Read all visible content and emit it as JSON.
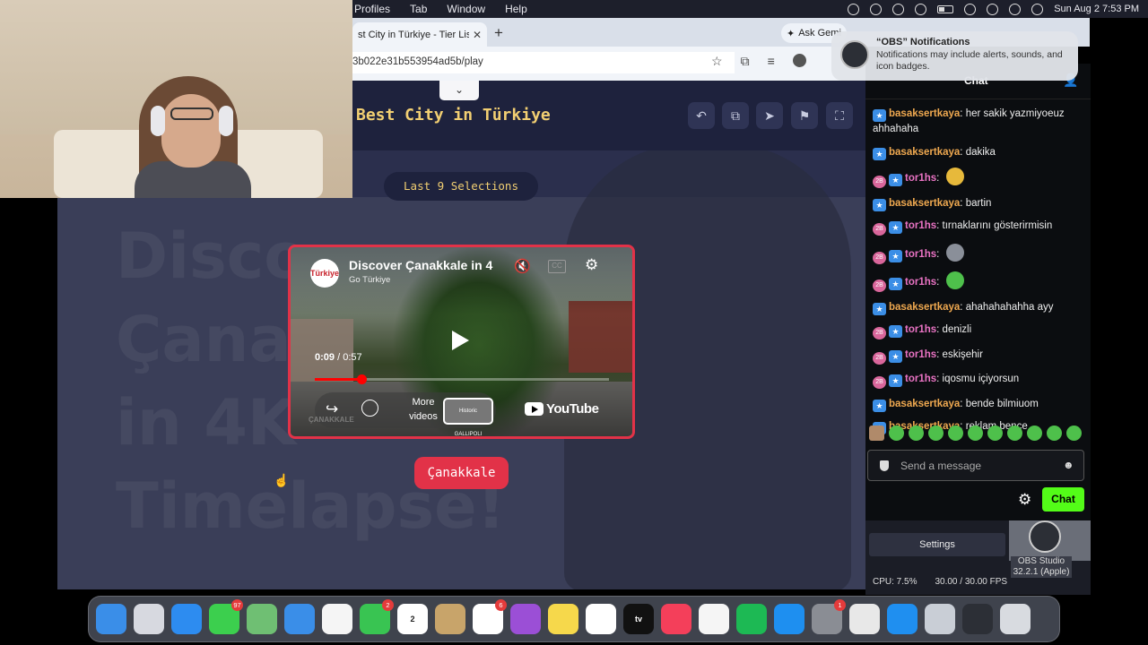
{
  "menubar": {
    "items": [
      "Profiles",
      "Tab",
      "Window",
      "Help"
    ],
    "clock": "Sun Aug 2  7:53 PM"
  },
  "browser": {
    "tab_title": "st City in Türkiye - Tier List",
    "ask_gemini": "Ask Gemi",
    "url": "3b022e31b553954ad5b/play",
    "popout_url": "kick.com/popout/dilaramirar/chat"
  },
  "game": {
    "title": "Best City in Türkiye",
    "last_selections": "Last 9 Selections",
    "city_button": "Çanakkale",
    "background_text": "Disco\nÇana\nin 4K\nTimelapse!",
    "video": {
      "title": "Discover Çanakkale in 4",
      "channel": "Go Türkiye",
      "logo_text": "Türkiye",
      "time_current": "0:09",
      "time_separator": " / ",
      "time_total": "0:57",
      "progress": 0.158,
      "more_videos": "More videos",
      "thumb_text": "Historic GALLIPOLI",
      "youtube": "YouTube",
      "watermark": "ÇANAKKALE"
    }
  },
  "notification": {
    "title": "“OBS” Notifications",
    "body": "Notifications may include alerts, sounds, and icon badges."
  },
  "chat": {
    "title": "Chat",
    "messages": [
      {
        "user": "basaksertkaya",
        "badges": [
          "blue"
        ],
        "text": "her sakik yazmiyoeuz ahhahaha"
      },
      {
        "user": "basaksertkaya",
        "badges": [
          "blue"
        ],
        "text": "dakika"
      },
      {
        "user": "tor1hs",
        "badges": [
          "pink",
          "blue"
        ],
        "text": "",
        "emote": "#e7b93b"
      },
      {
        "user": "basaksertkaya",
        "badges": [
          "blue"
        ],
        "text": "bartin"
      },
      {
        "user": "tor1hs",
        "badges": [
          "pink",
          "blue"
        ],
        "text": "tırnaklarını gösterirmisin"
      },
      {
        "user": "tor1hs",
        "badges": [
          "pink",
          "blue"
        ],
        "text": "",
        "emote": "#8a8f99"
      },
      {
        "user": "tor1hs",
        "badges": [
          "pink",
          "blue"
        ],
        "text": "",
        "emote": "#4ec04b"
      },
      {
        "user": "basaksertkaya",
        "badges": [
          "blue"
        ],
        "text": "ahahahahahha ayy"
      },
      {
        "user": "tor1hs",
        "badges": [
          "pink",
          "blue"
        ],
        "text": "denizli"
      },
      {
        "user": "tor1hs",
        "badges": [
          "pink",
          "blue"
        ],
        "text": "eskişehir"
      },
      {
        "user": "tor1hs",
        "badges": [
          "pink",
          "blue"
        ],
        "text": "iqosmu içiyorsun"
      },
      {
        "user": "basaksertkaya",
        "badges": [
          "blue"
        ],
        "text": "bende bilmiuom"
      },
      {
        "user": "basaksertkaya",
        "badges": [
          "blue"
        ],
        "text": "reklam bence"
      }
    ],
    "pink_badge_text": "2B",
    "input_placeholder": "Send a message",
    "send_button": "Chat"
  },
  "obs": {
    "settings": "Settings",
    "cpu": "CPU: 7.5%",
    "fps": "30.00 / 30.00 FPS",
    "studio_label": "OBS Studio 32.2.1 (Apple)"
  },
  "dock": {
    "apps": [
      {
        "name": "finder",
        "color": "#3a8ee8"
      },
      {
        "name": "launchpad",
        "color": "#d7d9e0"
      },
      {
        "name": "safari",
        "color": "#2d8cf0"
      },
      {
        "name": "messages",
        "color": "#3ccf4e",
        "badge": "97"
      },
      {
        "name": "maps",
        "color": "#6fbf73"
      },
      {
        "name": "mail",
        "color": "#3a8ee8"
      },
      {
        "name": "photos",
        "color": "#f5f5f5"
      },
      {
        "name": "facetime",
        "color": "#39c452",
        "badge": "2"
      },
      {
        "name": "calendar",
        "color": "#ffffff",
        "label": "2"
      },
      {
        "name": "contacts",
        "color": "#c8a46a"
      },
      {
        "name": "reminders",
        "color": "#ffffff",
        "badge": "6"
      },
      {
        "name": "podcasts",
        "color": "#9b4fd6"
      },
      {
        "name": "notes",
        "color": "#f6d84b"
      },
      {
        "name": "freeform",
        "color": "#ffffff"
      },
      {
        "name": "tv",
        "color": "#111111",
        "label": "tv"
      },
      {
        "name": "music",
        "color": "#f43f5a"
      },
      {
        "name": "news",
        "color": "#f5f5f5"
      },
      {
        "name": "spotify",
        "color": "#1db954"
      },
      {
        "name": "app-store",
        "color": "#1e8ff0"
      },
      {
        "name": "system-settings",
        "color": "#8a8d94",
        "badge": "1"
      },
      {
        "name": "chrome",
        "color": "#e8e8e8"
      },
      {
        "name": "prime-video",
        "color": "#1f8ff0"
      },
      {
        "name": "preview",
        "color": "#c9ced6"
      },
      {
        "name": "obs",
        "color": "#2c2f36"
      },
      {
        "name": "trash",
        "color": "#d8dbe0"
      }
    ]
  }
}
